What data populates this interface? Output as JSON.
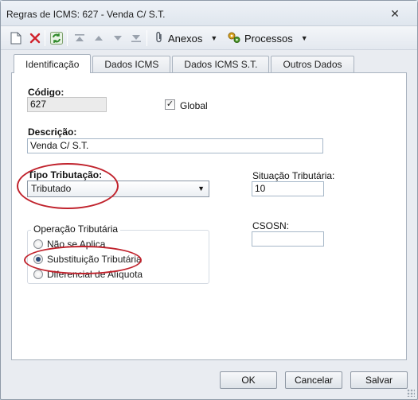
{
  "window": {
    "title": "Regras de ICMS: 627 - Venda  C/ S.T.",
    "close_glyph": "✕"
  },
  "toolbar": {
    "anexos_label": "Anexos",
    "processos_label": "Processos",
    "icons": [
      "new-document-icon",
      "delete-icon",
      "refresh-icon",
      "move-first-icon",
      "move-up-icon",
      "move-down-icon",
      "move-last-icon",
      "paperclip-icon",
      "gears-icon"
    ]
  },
  "tabs": [
    {
      "label": "Identificação",
      "active": true
    },
    {
      "label": "Dados ICMS",
      "active": false
    },
    {
      "label": "Dados ICMS S.T.",
      "active": false
    },
    {
      "label": "Outros Dados",
      "active": false
    }
  ],
  "form": {
    "codigo_label": "Código:",
    "codigo_value": "627",
    "global_label": "Global",
    "global_checked": true,
    "descricao_label": "Descrição:",
    "descricao_value": "Venda  C/ S.T.",
    "tipo_tributacao_label": "Tipo Tributação:",
    "tipo_tributacao_value": "Tributado",
    "situacao_tributaria_label": "Situação Tributária:",
    "situacao_tributaria_value": "10",
    "operacao_tributaria_label": "Operação Tributária",
    "operacao_options": [
      {
        "label": "Não se Aplica",
        "selected": false
      },
      {
        "label": "Substituição Tributária",
        "selected": true
      },
      {
        "label": "Diferencial de Alíquota",
        "selected": false
      }
    ],
    "csosn_label": "CSOSN:",
    "csosn_value": ""
  },
  "footer": {
    "ok_label": "OK",
    "cancelar_label": "Cancelar",
    "salvar_label": "Salvar"
  },
  "colors": {
    "annotation_red": "#c0222c",
    "field_border": "#a6b7c8",
    "window_bg": "#e9ecf1"
  }
}
